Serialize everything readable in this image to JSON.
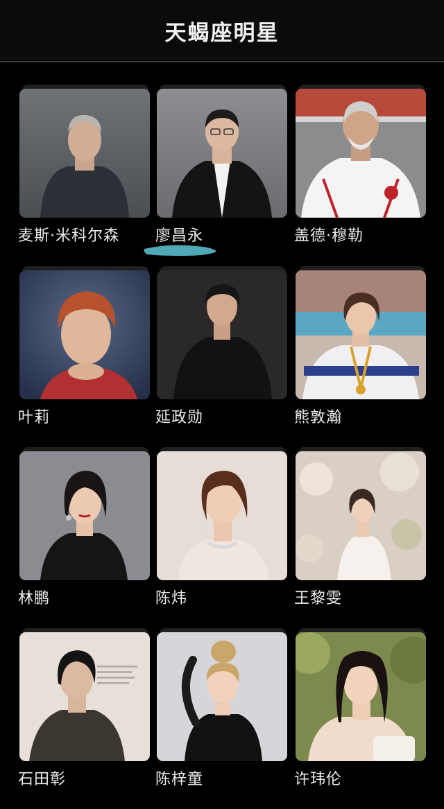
{
  "header": {
    "title": "天蝎座明星"
  },
  "celebrities": [
    {
      "name": "麦斯·米科尔森"
    },
    {
      "name": "廖昌永"
    },
    {
      "name": "盖德·穆勒"
    },
    {
      "name": "叶莉"
    },
    {
      "name": "延政勋"
    },
    {
      "name": "熊敦瀚"
    },
    {
      "name": "林鹏"
    },
    {
      "name": "陈炜"
    },
    {
      "name": "王黎雯"
    },
    {
      "name": "石田彰"
    },
    {
      "name": "陈梓童"
    },
    {
      "name": "许玮伦"
    }
  ],
  "colors": {
    "background": "#000000",
    "header_bg": "#0b0b0b",
    "text": "#ececec",
    "smudge": "#5ec6d6"
  }
}
